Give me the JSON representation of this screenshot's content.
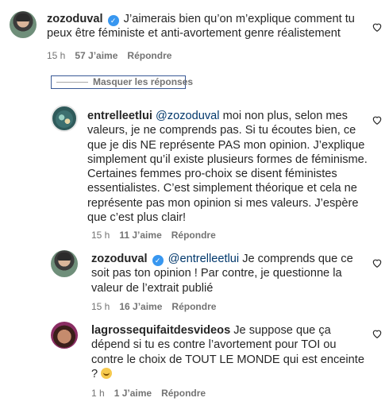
{
  "comments": [
    {
      "username": "zozoduval",
      "verified": true,
      "text": "J’aimerais bien qu’on m’explique comment tu peux être féministe et anti-avortement genre réalistement",
      "time": "15 h",
      "likes": "57 J’aime",
      "reply_label": "Répondre"
    }
  ],
  "hide_replies_label": "Masquer les réponses",
  "replies": [
    {
      "username": "entrelleetlui",
      "mention": "@zozoduval",
      "text": "moi non plus, selon mes valeurs, je ne comprends pas. Si tu écoutes bien, ce que je dis NE représente PAS mon opinion. J’explique simplement qu’il existe plusieurs formes de féminisme. Certaines femmes pro-choix se disent féministes essentialistes. C’est simplement théorique et cela ne représente pas mon opinion si mes valeurs. J’espère que c’est plus clair!",
      "time": "15 h",
      "likes": "11 J’aime",
      "reply_label": "Répondre"
    },
    {
      "username": "zozoduval",
      "verified": true,
      "mention": "@entrelleetlui",
      "text": "Je comprends que ce soit pas ton opinion ! Par contre, je questionne la valeur de l’extrait publié",
      "time": "15 h",
      "likes": "16 J’aime",
      "reply_label": "Répondre"
    },
    {
      "username": "lagrossequifaitdesvideos",
      "text": "Je suppose que ça dépend si tu es contre l’avortement pour TOI ou contre le choix de TOUT LE MONDE qui est enceinte ?",
      "emoji": "grimacing-face-emoji",
      "time": "1 h",
      "likes": "1 J’aime",
      "reply_label": "Répondre"
    }
  ],
  "icons": {
    "verified": "verified-badge-icon",
    "like": "heart-outline-icon"
  },
  "colors": {
    "text": "#262626",
    "meta": "#737373",
    "mention": "#00376b",
    "verified": "#3897f0"
  }
}
